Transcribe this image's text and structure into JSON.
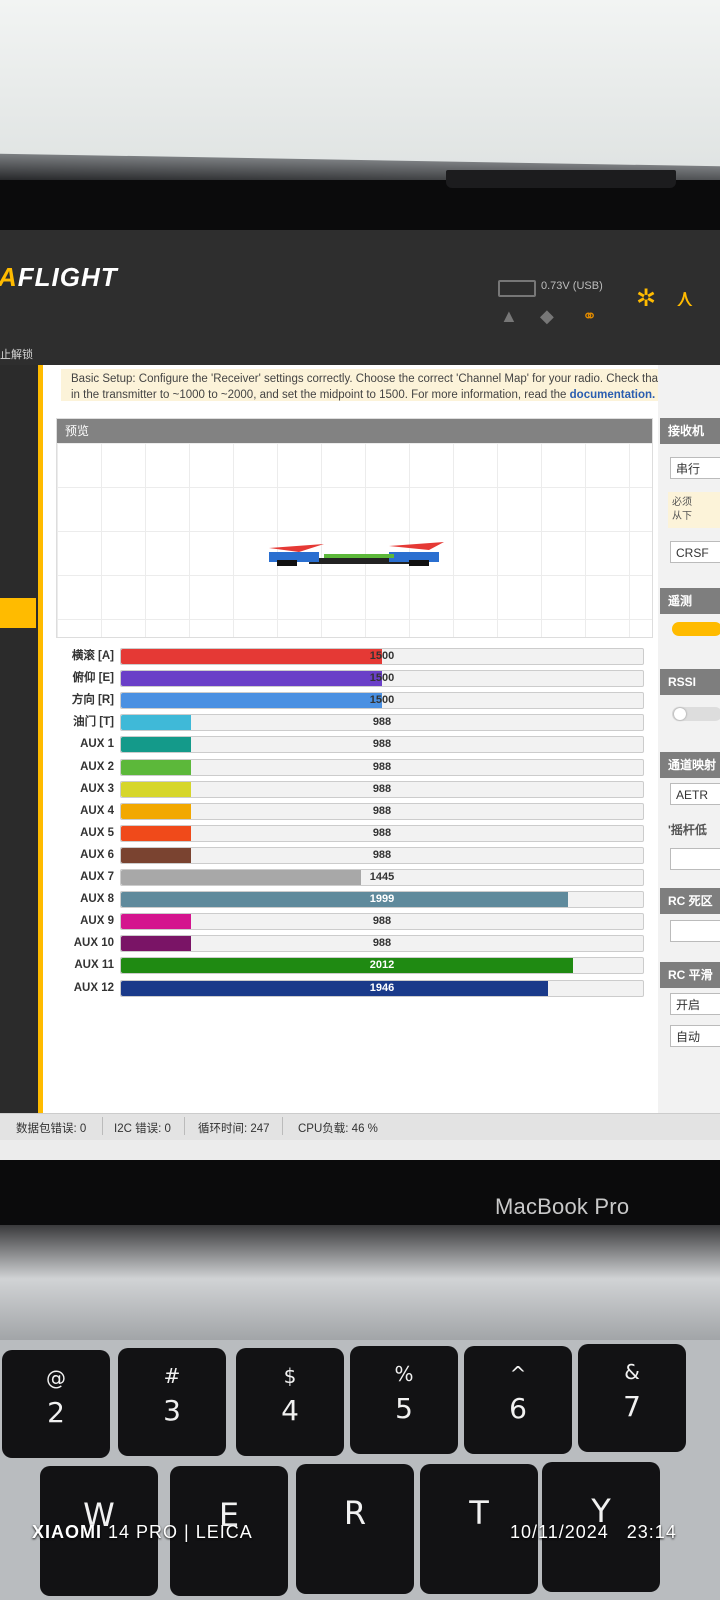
{
  "app": {
    "logo_prefix": "A",
    "logo_main": "FLIGHT",
    "voltage": "0.73V (USB)",
    "menu_label": "止解锁"
  },
  "notice": {
    "line1": "Basic Setup: Configure the 'Receiver' settings correctly. Choose the correct 'Channel Map' for your radio. Check that t",
    "line2_text": "in the transmitter to ~1000 to ~2000, and set the midpoint to 1500. For more information, read the ",
    "line2_link": "documentation."
  },
  "preview": {
    "title": "预览"
  },
  "channels": [
    {
      "name": "横滚 [A]",
      "value": 1500,
      "color": "#e53935"
    },
    {
      "name": "俯仰 [E]",
      "value": 1500,
      "color": "#6a3fc8"
    },
    {
      "name": "方向 [R]",
      "value": 1500,
      "color": "#4a90e2"
    },
    {
      "name": "油门 [T]",
      "value": 988,
      "color": "#3fb9d8"
    },
    {
      "name": "AUX 1",
      "value": 988,
      "color": "#149a8a"
    },
    {
      "name": "AUX 2",
      "value": 988,
      "color": "#5cb83a"
    },
    {
      "name": "AUX 3",
      "value": 988,
      "color": "#d6d62a"
    },
    {
      "name": "AUX 4",
      "value": 988,
      "color": "#f2a800"
    },
    {
      "name": "AUX 5",
      "value": 988,
      "color": "#f04a1a"
    },
    {
      "name": "AUX 6",
      "value": 988,
      "color": "#7a4330"
    },
    {
      "name": "AUX 7",
      "value": 1445,
      "color": "#a8a8a8"
    },
    {
      "name": "AUX 8",
      "value": 1999,
      "color": "#5f8a9c"
    },
    {
      "name": "AUX 9",
      "value": 988,
      "color": "#d4148e"
    },
    {
      "name": "AUX 10",
      "value": 988,
      "color": "#7a1466"
    },
    {
      "name": "AUX 11",
      "value": 2012,
      "color": "#1f8a12"
    },
    {
      "name": "AUX 12",
      "value": 1946,
      "color": "#1a3a8a"
    }
  ],
  "right_panel": {
    "receiver_title": "接收机",
    "receiver_mode": "串行",
    "notes": [
      "必须",
      "从下"
    ],
    "protocol": "CRSF",
    "telemetry_title": "遥测",
    "rssi_title": "RSSI",
    "channel_map_title": "通道映射",
    "channel_map_value": "AETR",
    "stick_low_title": "'摇杆低",
    "rc_deadband_title": "RC 死区",
    "rc_smoothing_title": "RC 平滑",
    "smoothing_value": "开启",
    "auto_value": "自动"
  },
  "status_bar": {
    "packet_errors": "数据包错误: 0",
    "i2c_errors": "I2C 错误: 0",
    "cycle_time": "循环时间: 247",
    "cpu_load": "CPU负载: 46 %"
  },
  "hardware": {
    "laptop_label": "MacBook Pro",
    "keys": [
      {
        "sym": "@",
        "num": "2"
      },
      {
        "sym": "#",
        "num": "3"
      },
      {
        "sym": "$",
        "num": "4"
      },
      {
        "sym": "%",
        "num": "5"
      },
      {
        "sym": "^",
        "num": "6"
      },
      {
        "sym": "&",
        "num": "7"
      }
    ],
    "letters": [
      "W",
      "E",
      "R",
      "T",
      "Y"
    ]
  },
  "photo": {
    "camera_brand": "XIAOMI",
    "camera_model": "14 PRO | LEICA",
    "date": "10/11/2024",
    "time": "23:14"
  }
}
